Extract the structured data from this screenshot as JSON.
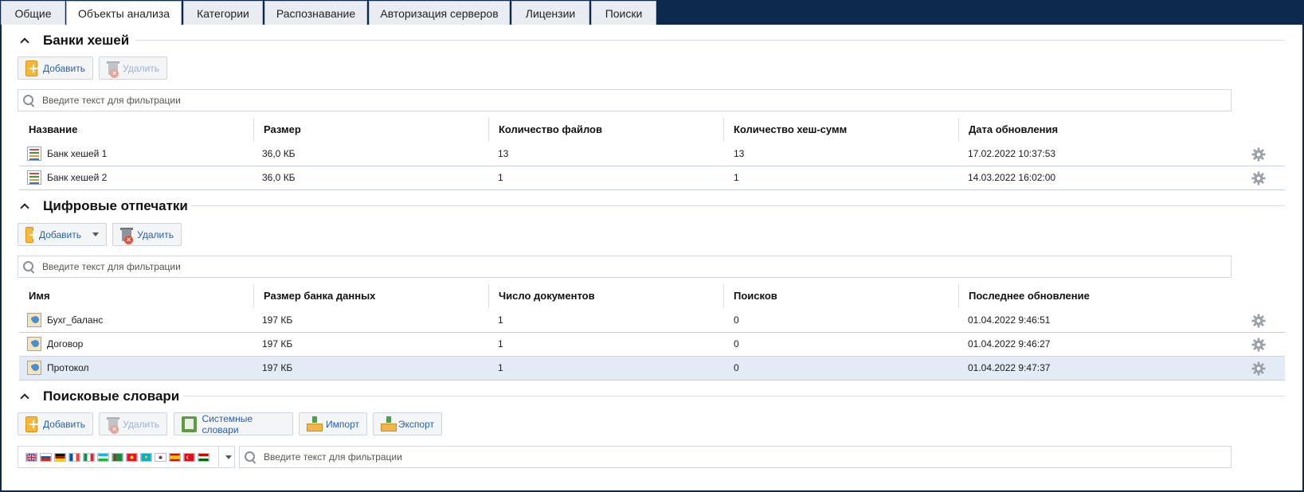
{
  "tabs": [
    {
      "label": "Общие",
      "active": false
    },
    {
      "label": "Объекты анализа",
      "active": true
    },
    {
      "label": "Категории",
      "active": false
    },
    {
      "label": "Распознавание",
      "active": false
    },
    {
      "label": "Авторизация серверов",
      "active": false
    },
    {
      "label": "Лицензии",
      "active": false
    },
    {
      "label": "Поиски",
      "active": false
    }
  ],
  "hash_banks": {
    "title": "Банки хешей",
    "add_label": "Добавить",
    "delete_label": "Удалить",
    "filter_placeholder": "Введите текст для фильтрации",
    "columns": [
      "Название",
      "Размер",
      "Количество файлов",
      "Количество хеш-сумм",
      "Дата обновления"
    ],
    "rows": [
      [
        "Банк хешей 1",
        "36,0 КБ",
        "13",
        "13",
        "17.02.2022 10:37:53"
      ],
      [
        "Банк хешей 2",
        "36,0 КБ",
        "1",
        "1",
        "14.03.2022 16:02:00"
      ]
    ]
  },
  "fingerprints": {
    "title": "Цифровые отпечатки",
    "add_label": "Добавить",
    "delete_label": "Удалить",
    "filter_placeholder": "Введите текст для фильтрации",
    "columns": [
      "Имя",
      "Размер банка данных",
      "Число документов",
      "Поисков",
      "Последнее обновление"
    ],
    "rows": [
      [
        "Бухг_баланс",
        "197 КБ",
        "1",
        "0",
        "01.04.2022 9:46:51"
      ],
      [
        "Договор",
        "197 КБ",
        "1",
        "0",
        "01.04.2022 9:46:27"
      ],
      [
        "Протокол",
        "197 КБ",
        "1",
        "0",
        "01.04.2022 9:47:37"
      ]
    ],
    "selected_row": 2
  },
  "dictionaries": {
    "title": "Поисковые словари",
    "add_label": "Добавить",
    "delete_label": "Удалить",
    "system_label": "Системные словари",
    "import_label": "Импорт",
    "export_label": "Экспорт",
    "filter_placeholder": "Введите текст для фильтрации",
    "flags": [
      "gb",
      "ru",
      "de",
      "fr",
      "it",
      "uz",
      "tm",
      "kg",
      "kz",
      "kr",
      "es",
      "tr",
      "tj"
    ]
  },
  "colors": {
    "accent": "#0d2a4d",
    "link": "#2a5fa8",
    "selected_row": "#e3ecf6"
  }
}
